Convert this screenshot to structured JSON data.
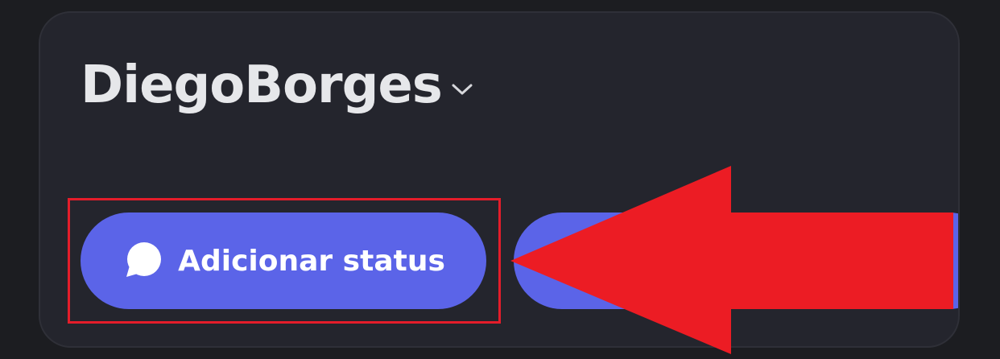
{
  "profile": {
    "username": "DiegoBorges",
    "username_menu_icon": "chevron-down-icon"
  },
  "actions": {
    "status_button": {
      "label": "Adicionar status",
      "icon": "speech-bubble-icon"
    }
  },
  "annotation": {
    "highlight_color": "#e41d2a",
    "arrow_color": "#ec1c24",
    "arrow_icon": "left-arrow-annotation"
  },
  "colors": {
    "background": "#1c1d21",
    "card": "#24252d",
    "accent": "#5b64e8",
    "text": "#e6e7ea"
  }
}
